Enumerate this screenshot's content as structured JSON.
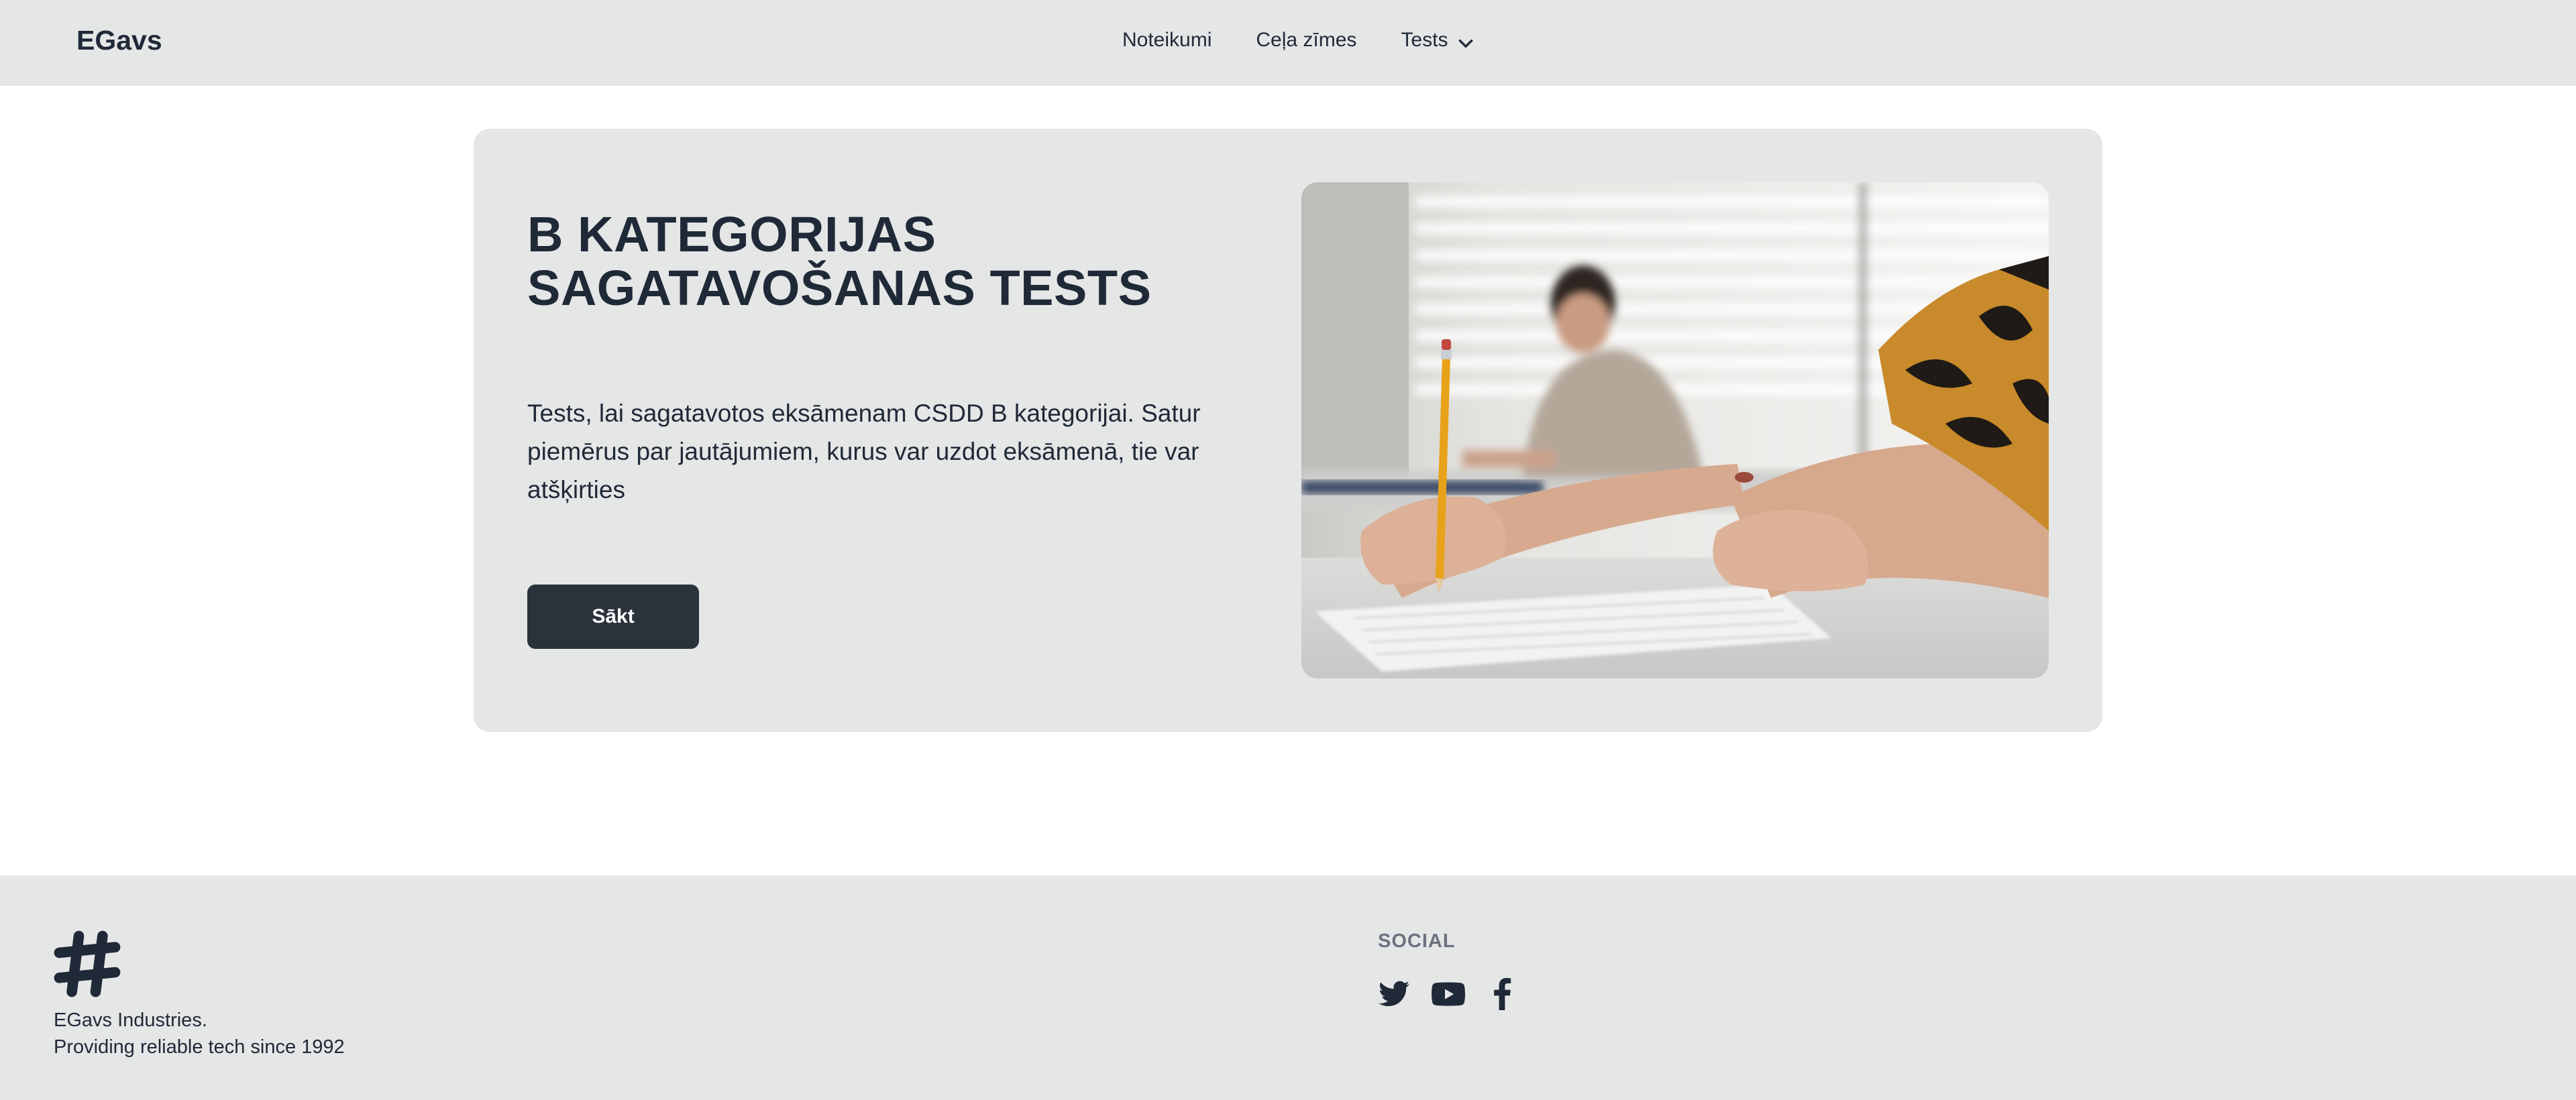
{
  "navbar": {
    "brand": "EGavs",
    "links": [
      {
        "label": "Noteikumi"
      },
      {
        "label": "Ceļa zīmes"
      },
      {
        "label": "Tests",
        "icon": "chevron-down-icon"
      }
    ]
  },
  "hero": {
    "title_line1": "B KATEGORIJAS",
    "title_line2": "SAGATAVOŠANAS TESTS",
    "description": "Tests, lai sagatavotos eksāmenam CSDD B kategorijai. Satur piemērus par jautājumiem, kurus var uzdot eksāmenā, tie var atšķirties",
    "button_label": "Sākt",
    "image": "exam-photo"
  },
  "footer": {
    "logo_icon": "hashtag-logo-icon",
    "company": "EGavs Industries.",
    "tagline": "Providing reliable tech since 1992",
    "social_title": "SOCIAL",
    "social_icons": [
      "twitter-icon",
      "youtube-icon",
      "facebook-icon"
    ]
  },
  "colors": {
    "bar_bg": "#e5e6e6",
    "text": "#1f2937",
    "button_bg": "#2a323c",
    "muted": "#6b7280"
  }
}
